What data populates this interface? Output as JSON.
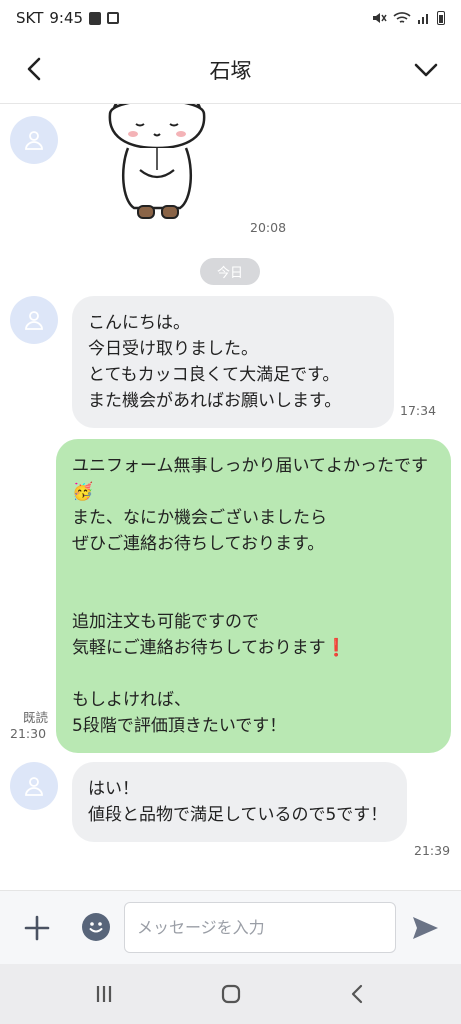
{
  "status_bar": {
    "carrier": "SKT",
    "time": "9:45"
  },
  "header": {
    "title": "石塚",
    "back_icon": "chevron-left-icon",
    "menu_icon": "chevron-down-icon"
  },
  "chat": {
    "sticker": {
      "time": "20:08"
    },
    "date_chip": "今日",
    "messages": [
      {
        "side": "in",
        "text": "こんにちは。\n今日受け取りました。\nとてもカッコ良くて大満足です。\nまた機会があればお願いします。",
        "time": "17:34"
      },
      {
        "side": "out",
        "text": "ユニフォーム無事しっかり届いてよかったです🥳\nまた、なにか機会ございましたら\nぜひご連絡お待ちしております。\n\n\n追加注文も可能ですので\n気軽にご連絡お待ちしております❗\n\nもしよければ、\n5段階で評価頂きたいです！",
        "time": "21:30",
        "read": "既読"
      },
      {
        "side": "in",
        "text": "はい！\n値段と品物で満足しているので5です！",
        "time": "21:39"
      }
    ]
  },
  "input_bar": {
    "placeholder": "メッセージを入力",
    "plus_icon": "plus-icon",
    "emoji_icon": "emoji-icon",
    "send_icon": "send-icon"
  },
  "nav_bar": {
    "recents_icon": "recents-icon",
    "home_icon": "home-icon",
    "back_icon": "back-icon"
  },
  "colors": {
    "incoming_bubble": "#eeeff1",
    "outgoing_bubble": "#b9e8b3",
    "avatar_bg": "#dde6f8",
    "send": "#6a7386"
  }
}
